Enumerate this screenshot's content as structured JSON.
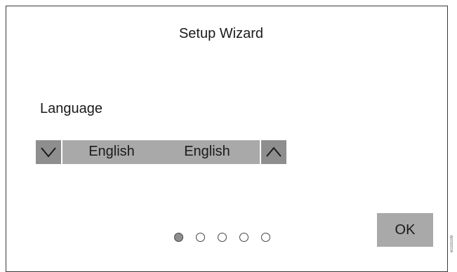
{
  "wizard": {
    "title": "Setup Wizard",
    "field_label": "Language",
    "options_visible": [
      "English",
      "English"
    ],
    "ok_label": "OK",
    "page_indicator": {
      "total": 5,
      "current": 1
    }
  },
  "side_code": "w103109",
  "colors": {
    "button_dark": "#8e8e8e",
    "button_light": "#a9a9a9",
    "border": "#3a3a3a"
  },
  "icons": {
    "down": "chevron-down-icon",
    "up": "chevron-up-icon"
  }
}
